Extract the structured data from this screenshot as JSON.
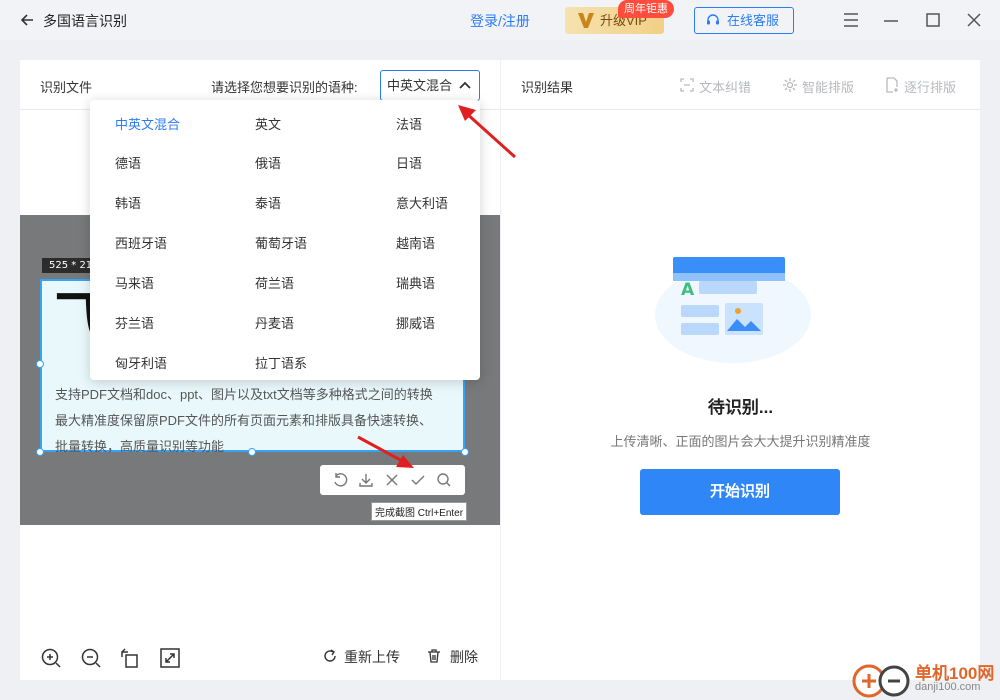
{
  "title_bar": {
    "title": "多国语言识别",
    "login": "登录/注册",
    "vip_label": "升级VIP",
    "vip_badge": "周年钜惠",
    "service": "在线客服"
  },
  "left_panel": {
    "label": "识别文件",
    "lang_prompt": "请选择您想要识别的语种:",
    "selected_language": "中英文混合",
    "preview": {
      "size_tag": "525 * 213",
      "big_char": "飞",
      "lines": [
        "支持PDF文档和doc、ppt、图片以及txt文档等多种格式之间的转换",
        "最大精准度保留原PDF文件的所有页面元素和排版具备快速转换、",
        "批量转换，高质量识别等功能"
      ],
      "tooltip": "完成截图 Ctrl+Enter"
    },
    "bottom": {
      "reupload": "重新上传",
      "delete": "删除"
    }
  },
  "dropdown": {
    "languages": [
      "中英文混合",
      "英文",
      "法语",
      "德语",
      "俄语",
      "日语",
      "韩语",
      "泰语",
      "意大利语",
      "西班牙语",
      "葡萄牙语",
      "越南语",
      "马来语",
      "荷兰语",
      "瑞典语",
      "芬兰语",
      "丹麦语",
      "挪威语",
      "匈牙利语",
      "拉丁语系"
    ]
  },
  "right_panel": {
    "label": "识别结果",
    "tools": [
      "文本纠错",
      "智能排版",
      "逐行排版"
    ],
    "status": "待识别...",
    "hint": "上传清晰、正面的图片会大大提升识别精准度",
    "start_button": "开始识别"
  },
  "watermark": {
    "name": "单机100网",
    "url": "danji100.com"
  },
  "colors": {
    "accent": "#2b7cf6",
    "arrow": "#e02020",
    "vip_badge": "#ff4d3d"
  }
}
